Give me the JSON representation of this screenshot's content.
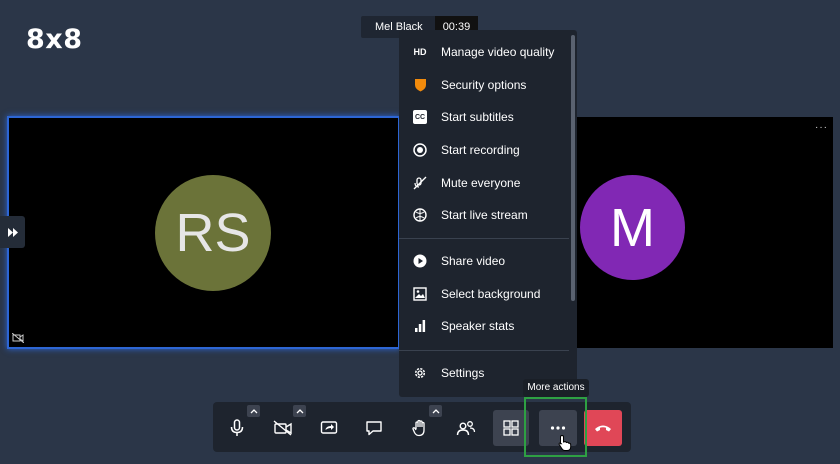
{
  "app": {
    "logo": "8x8"
  },
  "header": {
    "participant_name": "Mel Black",
    "timer": "00:39"
  },
  "tiles": [
    {
      "initials": "RS",
      "color": "#6b7339"
    },
    {
      "initials": "M",
      "color": "#8128b4"
    }
  ],
  "tile_menu_label": "···",
  "more_menu": {
    "items": [
      {
        "label": "Manage video quality",
        "icon": "hd-icon",
        "icon_text": "HD"
      },
      {
        "label": "Security options",
        "icon": "shield-icon"
      },
      {
        "label": "Start subtitles",
        "icon": "cc-icon",
        "icon_text": "CC"
      },
      {
        "label": "Start recording",
        "icon": "record-icon"
      },
      {
        "label": "Mute everyone",
        "icon": "mute-everyone-icon"
      },
      {
        "label": "Start live stream",
        "icon": "live-stream-icon"
      },
      {
        "label": "Share video",
        "icon": "play-icon"
      },
      {
        "label": "Select background",
        "icon": "image-icon"
      },
      {
        "label": "Speaker stats",
        "icon": "bar-chart-icon"
      },
      {
        "label": "Settings",
        "icon": "gear-icon"
      }
    ]
  },
  "tooltip": "More actions",
  "toolbar": {
    "buttons": [
      "microphone",
      "camera-off",
      "share-screen",
      "chat",
      "raise-hand",
      "participants",
      "tile-view",
      "more-actions",
      "hang-up"
    ],
    "hangup_color": "#e04757",
    "accent": "#2ea043"
  }
}
